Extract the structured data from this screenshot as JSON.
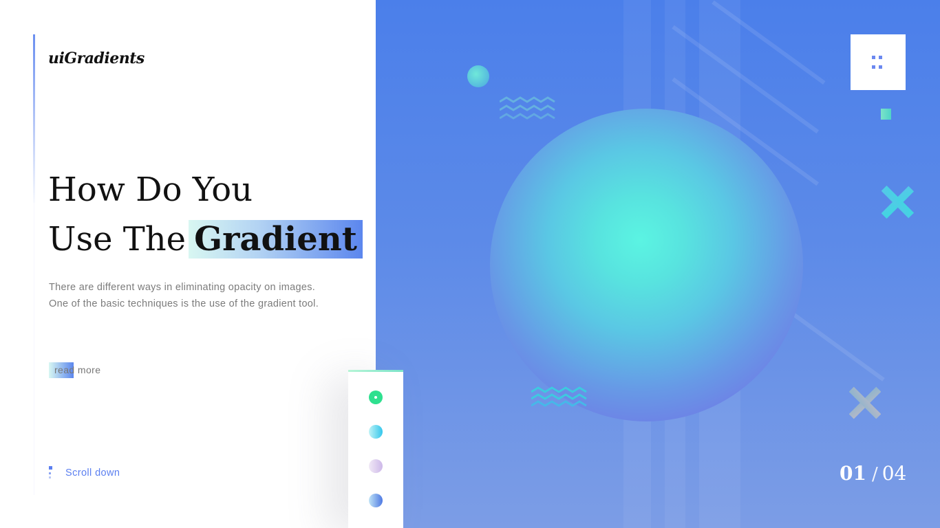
{
  "brand": {
    "logo": "uiGradients"
  },
  "hero": {
    "line1": "How Do You",
    "line2_prefix": "Use The",
    "line2_highlight": "Gradient",
    "description": "There are different ways in eliminating opacity on images. One of the basic techniques is the use of the gradient tool.",
    "read_more_label": "read more"
  },
  "scroll": {
    "label": "Scroll down"
  },
  "pager": {
    "current": "01",
    "separator": "/",
    "total": "04"
  },
  "slides": {
    "count": 4,
    "active_index": 1,
    "dot_colors": [
      "#2ee08f",
      "#33c6ec",
      "#cdb8e9",
      "#4e79e3"
    ]
  },
  "menu": {
    "icon": "grid-dots-icon"
  },
  "colors": {
    "accent": "#5b7ff0",
    "panel_top": "#4b7fea",
    "panel_bottom": "#7c9de6",
    "sphere_highlight": "#5bf4e2"
  }
}
